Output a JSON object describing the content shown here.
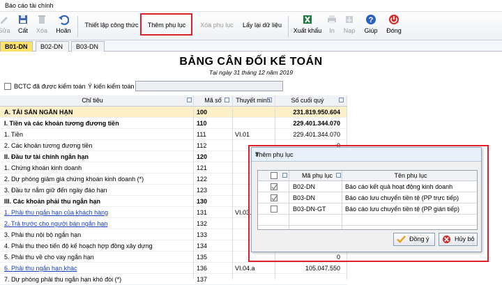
{
  "window": {
    "title": "Báo cáo tài chính"
  },
  "toolbar": {
    "buttons": [
      {
        "id": "sua",
        "label": "Sửa",
        "disabled": true
      },
      {
        "id": "cat",
        "label": "Cất",
        "disabled": false
      },
      {
        "id": "xoa",
        "label": "Xóa",
        "disabled": true
      },
      {
        "id": "hoan",
        "label": "Hoãn",
        "disabled": false
      },
      {
        "id": "thiet_lap",
        "label": "Thiết lập công thức",
        "disabled": false
      },
      {
        "id": "them_phu_luc",
        "label": "Thêm phụ lục",
        "disabled": false
      },
      {
        "id": "xoa_phu_luc",
        "label": "Xóa phụ lục",
        "disabled": true
      },
      {
        "id": "lay_lai",
        "label": "Lấy lại dữ liệu",
        "disabled": false
      },
      {
        "id": "xuat_khau",
        "label": "Xuất khẩu",
        "disabled": false
      },
      {
        "id": "in",
        "label": "In",
        "disabled": true
      },
      {
        "id": "nap",
        "label": "Nạp",
        "disabled": true
      },
      {
        "id": "giup",
        "label": "Giúp",
        "disabled": false
      },
      {
        "id": "dong",
        "label": "Đóng",
        "disabled": false
      }
    ]
  },
  "tabs": [
    {
      "label": "B01-DN",
      "active": true
    },
    {
      "label": "B02-DN",
      "active": false
    },
    {
      "label": "B03-DN",
      "active": false
    }
  ],
  "report": {
    "title": "BẢNG CÂN ĐỐI KẾ TOÁN",
    "date": "Tại ngày 31 tháng 12 năm 2019",
    "audited_label": "BCTC đã được kiểm toán",
    "audit_opinion_label": "Ý kiến kiểm toán",
    "audit_opinion_value": ""
  },
  "grid": {
    "columns": [
      "Chỉ tiêu",
      "Mã số",
      "Thuyết minh",
      "Số cuối quý"
    ],
    "rows": [
      {
        "chi_tieu": "A. TÀI SẢN NGẮN HẠN",
        "ma_so": "100",
        "thuyet_minh": "",
        "so_cuoi_quy": "231.819.950.604",
        "style": "hi-bold"
      },
      {
        "chi_tieu": "I. Tiền và các khoản tương đương tiền",
        "ma_so": "110",
        "thuyet_minh": "",
        "so_cuoi_quy": "229.401.344.070",
        "style": "bold"
      },
      {
        "chi_tieu": "1. Tiền",
        "ma_so": "111",
        "thuyet_minh": "VI.01",
        "so_cuoi_quy": "229.401.344.070",
        "style": ""
      },
      {
        "chi_tieu": "2. Các khoản tương đương tiền",
        "ma_so": "112",
        "thuyet_minh": "",
        "so_cuoi_quy": "0",
        "style": ""
      },
      {
        "chi_tieu": "II. Đầu tư tài chính ngắn hạn",
        "ma_so": "120",
        "thuyet_minh": "",
        "so_cuoi_quy": "",
        "style": "bold"
      },
      {
        "chi_tieu": "1. Chứng khoán kinh doanh",
        "ma_so": "121",
        "thuyet_minh": "",
        "so_cuoi_quy": "",
        "style": ""
      },
      {
        "chi_tieu": "2. Dự phòng giảm giá chứng khoán kinh doanh (*)",
        "ma_so": "122",
        "thuyet_minh": "",
        "so_cuoi_quy": "",
        "style": ""
      },
      {
        "chi_tieu": "3. Đầu tư nắm giữ đến ngày đáo hạn",
        "ma_so": "123",
        "thuyet_minh": "",
        "so_cuoi_quy": "",
        "style": ""
      },
      {
        "chi_tieu": "III. Các khoản phải thu ngắn hạn",
        "ma_so": "130",
        "thuyet_minh": "",
        "so_cuoi_quy": "",
        "style": "bold"
      },
      {
        "chi_tieu": "1. Phải thu ngắn hạn của khách hàng",
        "ma_so": "131",
        "thuyet_minh": "VI.03.",
        "so_cuoi_quy": "",
        "style": "link"
      },
      {
        "chi_tieu": "2. Trả trước cho người bán ngắn hạn",
        "ma_so": "132",
        "thuyet_minh": "",
        "so_cuoi_quy": "",
        "style": "link"
      },
      {
        "chi_tieu": "3. Phải thu nội bộ ngắn hạn",
        "ma_so": "133",
        "thuyet_minh": "",
        "so_cuoi_quy": "",
        "style": ""
      },
      {
        "chi_tieu": "4. Phải thu theo tiến độ kế hoạch hợp đồng xây dựng",
        "ma_so": "134",
        "thuyet_minh": "",
        "so_cuoi_quy": "",
        "style": ""
      },
      {
        "chi_tieu": "5. Phải thu về cho vay ngắn hạn",
        "ma_so": "135",
        "thuyet_minh": "",
        "so_cuoi_quy": "0",
        "style": ""
      },
      {
        "chi_tieu": "6. Phải thu ngắn hạn khác",
        "ma_so": "136",
        "thuyet_minh": "VI.04.a",
        "so_cuoi_quy": "105.047.550",
        "style": "link"
      },
      {
        "chi_tieu": "7. Dự phòng phải thu ngắn hạn khó đòi (*)",
        "ma_so": "137",
        "thuyet_minh": "",
        "so_cuoi_quy": "",
        "style": ""
      }
    ]
  },
  "dialog": {
    "title": "Thêm phụ lục",
    "help": "?",
    "close": "×",
    "columns": [
      "Mã phụ lục",
      "Tên phụ lục"
    ],
    "rows": [
      {
        "ma": "B02-DN",
        "ten": "Báo cáo kết quả hoạt động kinh doanh",
        "checked": true
      },
      {
        "ma": "B03-DN",
        "ten": "Báo cáo lưu chuyển tiền tệ (PP trực tiếp)",
        "checked": true
      },
      {
        "ma": "B03-DN-GT",
        "ten": "Báo cáo lưu chuyển tiền tệ (PP gián tiếp)",
        "checked": false
      }
    ],
    "ok_label": "Đồng ý",
    "cancel_label": "Hủy bỏ"
  },
  "colors": {
    "highlight": "#e0202a",
    "active_tab": "#fbe36a",
    "row_highlight": "#fdf0c8",
    "link": "#1a3fc2"
  }
}
